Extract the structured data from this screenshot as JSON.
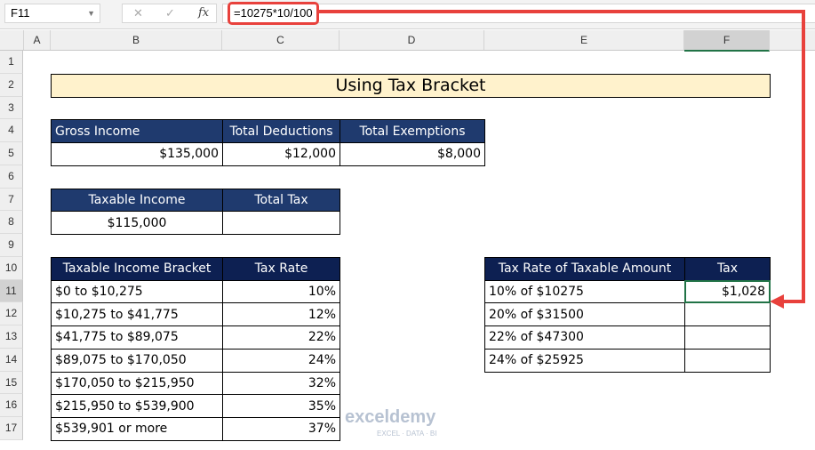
{
  "formula_bar": {
    "name_box": "F11",
    "cancel": "✕",
    "enter": "✓",
    "fx": "fx",
    "formula": "=10275*10/100"
  },
  "columns": [
    "A",
    "B",
    "C",
    "D",
    "E",
    "F"
  ],
  "rows": [
    "1",
    "2",
    "3",
    "4",
    "5",
    "6",
    "7",
    "8",
    "9",
    "10",
    "11",
    "12",
    "13",
    "14",
    "15",
    "16",
    "17"
  ],
  "title": "Using Tax Bracket",
  "income_table": {
    "headers": [
      "Gross Income",
      "Total Deductions",
      "Total Exemptions"
    ],
    "values": [
      "$135,000",
      "$12,000",
      "$8,000"
    ]
  },
  "taxable_table": {
    "headers": [
      "Taxable Income",
      "Total Tax"
    ],
    "values": [
      "$115,000",
      ""
    ]
  },
  "bracket_table": {
    "headers": [
      "Taxable Income Bracket",
      "Tax Rate"
    ],
    "rows": [
      [
        "$0 to $10,275",
        "10%"
      ],
      [
        "$10,275 to $41,775",
        "12%"
      ],
      [
        "$41,775 to $89,075",
        "22%"
      ],
      [
        "$89,075 to $170,050",
        "24%"
      ],
      [
        "$170,050 to $215,950",
        "32%"
      ],
      [
        "$215,950 to $539,900",
        "35%"
      ],
      [
        "$539,901 or more",
        "37%"
      ]
    ]
  },
  "tax_table": {
    "headers": [
      "Tax Rate of Taxable Amount",
      "Tax"
    ],
    "rows": [
      [
        "10% of $10275",
        "$1,028"
      ],
      [
        "20% of $31500",
        ""
      ],
      [
        "22% of $47300",
        ""
      ],
      [
        "24% of $25925",
        ""
      ]
    ]
  },
  "watermark": {
    "name": "exceldemy",
    "tagline": "EXCEL · DATA · BI"
  },
  "colors": {
    "header": "#0d2052",
    "title_fill": "#fff2cc",
    "selection": "#217346",
    "arrow": "#e8413c"
  }
}
